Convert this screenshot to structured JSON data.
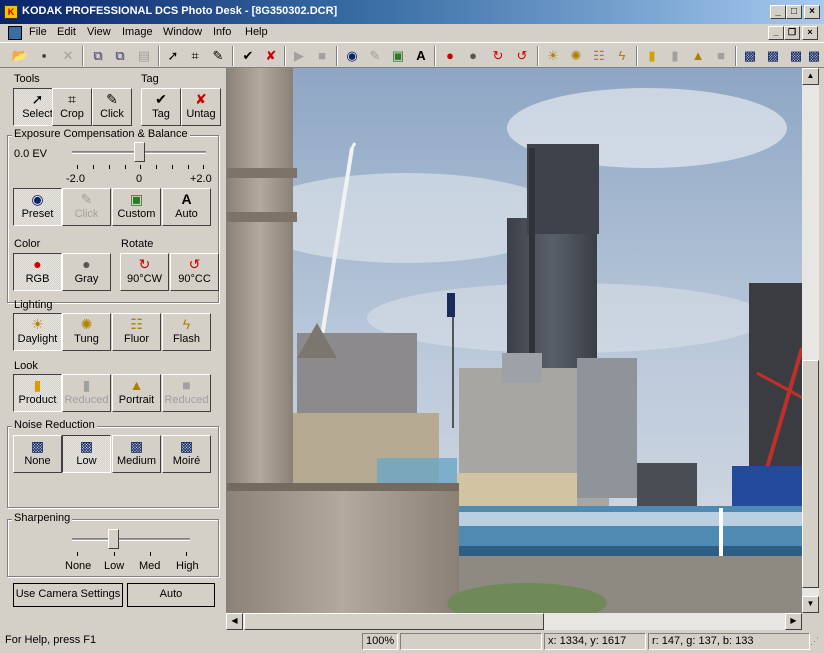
{
  "window": {
    "title": "KODAK PROFESSIONAL DCS Photo Desk - [8G350302.DCR]",
    "app_icon": "kodak-icon",
    "minimize": "_",
    "maximize": "□",
    "close": "×"
  },
  "menu": {
    "items": [
      "File",
      "Edit",
      "View",
      "Image",
      "Window",
      "Info",
      "Help"
    ],
    "mdi_minimize": "_",
    "mdi_restore": "❐",
    "mdi_close": "×"
  },
  "toolbar": {
    "icons": [
      "open-icon",
      "save-icon",
      "close-doc-icon",
      "copy-icon",
      "paste-icon",
      "print-icon",
      "select-arrow-icon",
      "crop-icon",
      "eyedropper-icon",
      "tag-icon",
      "untag-icon",
      "play-icon",
      "stop-icon",
      "preset-icon",
      "click-balance-icon",
      "custom-balance-icon",
      "auto-balance-icon",
      "rgb-icon",
      "gray-icon",
      "rotate-cw-icon",
      "rotate-ccw-icon",
      "daylight-icon",
      "tungsten-icon",
      "fluorescent-icon",
      "flash-icon",
      "product-look-icon",
      "reduced-look-icon",
      "portrait-look-icon",
      "reduced-look-2-icon",
      "noise-none-icon",
      "noise-low-icon",
      "noise-medium-icon",
      "noise-moire-icon"
    ]
  },
  "panel": {
    "tools_label": "Tools",
    "tag_label": "Tag",
    "tools": [
      {
        "label": "Select",
        "icon": "arrow-cursor-icon",
        "glyph": "➚"
      },
      {
        "label": "Crop",
        "icon": "crop-icon",
        "glyph": "⌗"
      },
      {
        "label": "Click",
        "icon": "eyedropper-icon",
        "glyph": "✎"
      }
    ],
    "tag_buttons": [
      {
        "label": "Tag",
        "icon": "checkmark-icon",
        "glyph": "✔"
      },
      {
        "label": "Untag",
        "icon": "untag-icon",
        "glyph": "✘"
      }
    ],
    "exposure": {
      "legend": "Exposure Compensation & Balance",
      "value": "0.0 EV",
      "ticks": [
        "-2.0",
        "0",
        "+2.0"
      ],
      "buttons": [
        {
          "label": "Preset",
          "icon": "preset-icon",
          "glyph": "◉"
        },
        {
          "label": "Click",
          "icon": "eyedropper-icon",
          "glyph": "✎"
        },
        {
          "label": "Custom",
          "icon": "custom-balance-icon",
          "glyph": "▣"
        },
        {
          "label": "Auto",
          "icon": "auto-balance-icon",
          "glyph": "A"
        }
      ]
    },
    "color_label": "Color",
    "rotate_label": "Rotate",
    "color_buttons": [
      {
        "label": "RGB",
        "icon": "rgb-circles-icon",
        "glyph": "●"
      },
      {
        "label": "Gray",
        "icon": "gray-circles-icon",
        "glyph": "●"
      }
    ],
    "rotate_buttons": [
      {
        "label": "90°CW",
        "icon": "rotate-cw-icon",
        "glyph": "↻"
      },
      {
        "label": "90°CC",
        "icon": "rotate-ccw-icon",
        "glyph": "↺"
      }
    ],
    "lighting_label": "Lighting",
    "lighting_buttons": [
      {
        "label": "Daylight",
        "icon": "sun-icon",
        "glyph": "☀"
      },
      {
        "label": "Tung",
        "icon": "tungsten-icon",
        "glyph": "✺"
      },
      {
        "label": "Fluor",
        "icon": "fluorescent-icon",
        "glyph": "☷"
      },
      {
        "label": "Flash",
        "icon": "flash-icon",
        "glyph": "ϟ"
      }
    ],
    "look_label": "Look",
    "look_buttons": [
      {
        "label": "Product",
        "icon": "product-icon",
        "glyph": "▮"
      },
      {
        "label": "Reduced",
        "icon": "reduced-icon",
        "glyph": "▮"
      },
      {
        "label": "Portrait",
        "icon": "portrait-icon",
        "glyph": "▲"
      },
      {
        "label": "Reduced",
        "icon": "reduced-icon",
        "glyph": "■"
      }
    ],
    "noise": {
      "legend": "Noise Reduction",
      "buttons": [
        {
          "label": "None",
          "icon": "noise-none-icon",
          "glyph": "▩"
        },
        {
          "label": "Low",
          "icon": "noise-low-icon",
          "glyph": "▩"
        },
        {
          "label": "Medium",
          "icon": "noise-medium-icon",
          "glyph": "▩"
        },
        {
          "label": "Moiré",
          "icon": "noise-moire-icon",
          "glyph": "▩"
        }
      ]
    },
    "sharpening": {
      "legend": "Sharpening",
      "ticks": [
        "None",
        "Low",
        "Med",
        "High"
      ],
      "value": "Low"
    },
    "use_camera_settings": "Use Camera Settings",
    "auto": "Auto"
  },
  "status": {
    "help": "For Help, press F1",
    "zoom": "100%",
    "coords": "x: 1334,  y: 1617",
    "rgb": "r: 147,  g: 137,  b: 133"
  },
  "colors": {
    "title_start": "#0a246a",
    "title_end": "#a6caf0",
    "face": "#d4d0c8"
  }
}
